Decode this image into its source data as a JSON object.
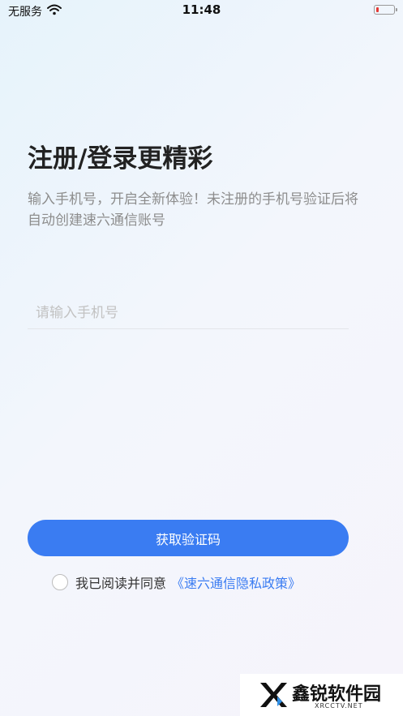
{
  "status_bar": {
    "carrier": "无服务",
    "time": "11:48",
    "wifi_icon": "wifi-icon",
    "battery_icon": "battery-icon",
    "battery_color": "#e53935"
  },
  "login": {
    "title": "注册/登录更精彩",
    "description": "输入手机号，开启全新体验！未注册的手机号验证后将自动创建速六通信账号",
    "phone_placeholder": "请输入手机号",
    "phone_value": "",
    "get_code_label": "获取验证码",
    "agree_text": "我已阅读并同意",
    "policy_link": "《速六通信隐私政策》"
  },
  "watermark": {
    "name": "鑫锐软件园",
    "url": "XRCCTV.NET"
  },
  "colors": {
    "accent": "#3a7cf2",
    "title_text": "#222222",
    "muted_text": "#8d8d8d"
  }
}
